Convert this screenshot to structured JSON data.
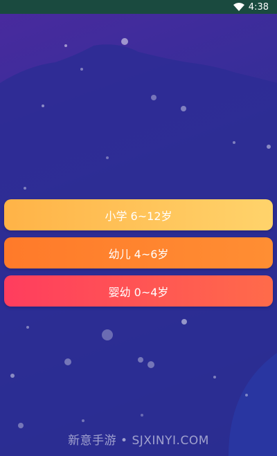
{
  "status_bar": {
    "time": "4:38"
  },
  "menu": {
    "items": [
      {
        "label": "小学 6~12岁"
      },
      {
        "label": "幼儿 4~6岁"
      },
      {
        "label": "婴幼 0~4岁"
      }
    ]
  },
  "watermark": {
    "text": "新意手游 • SJXINYI.COM"
  },
  "colors": {
    "status_bar": "#1a4a3f",
    "background_top": "#4a2a9e",
    "background_bottom": "#1f2d7e",
    "button_primary": "#ffc55a",
    "button_kids": "#ff8030",
    "button_baby": "#ff4a58"
  },
  "icons": {
    "wifi": "wifi-icon"
  }
}
